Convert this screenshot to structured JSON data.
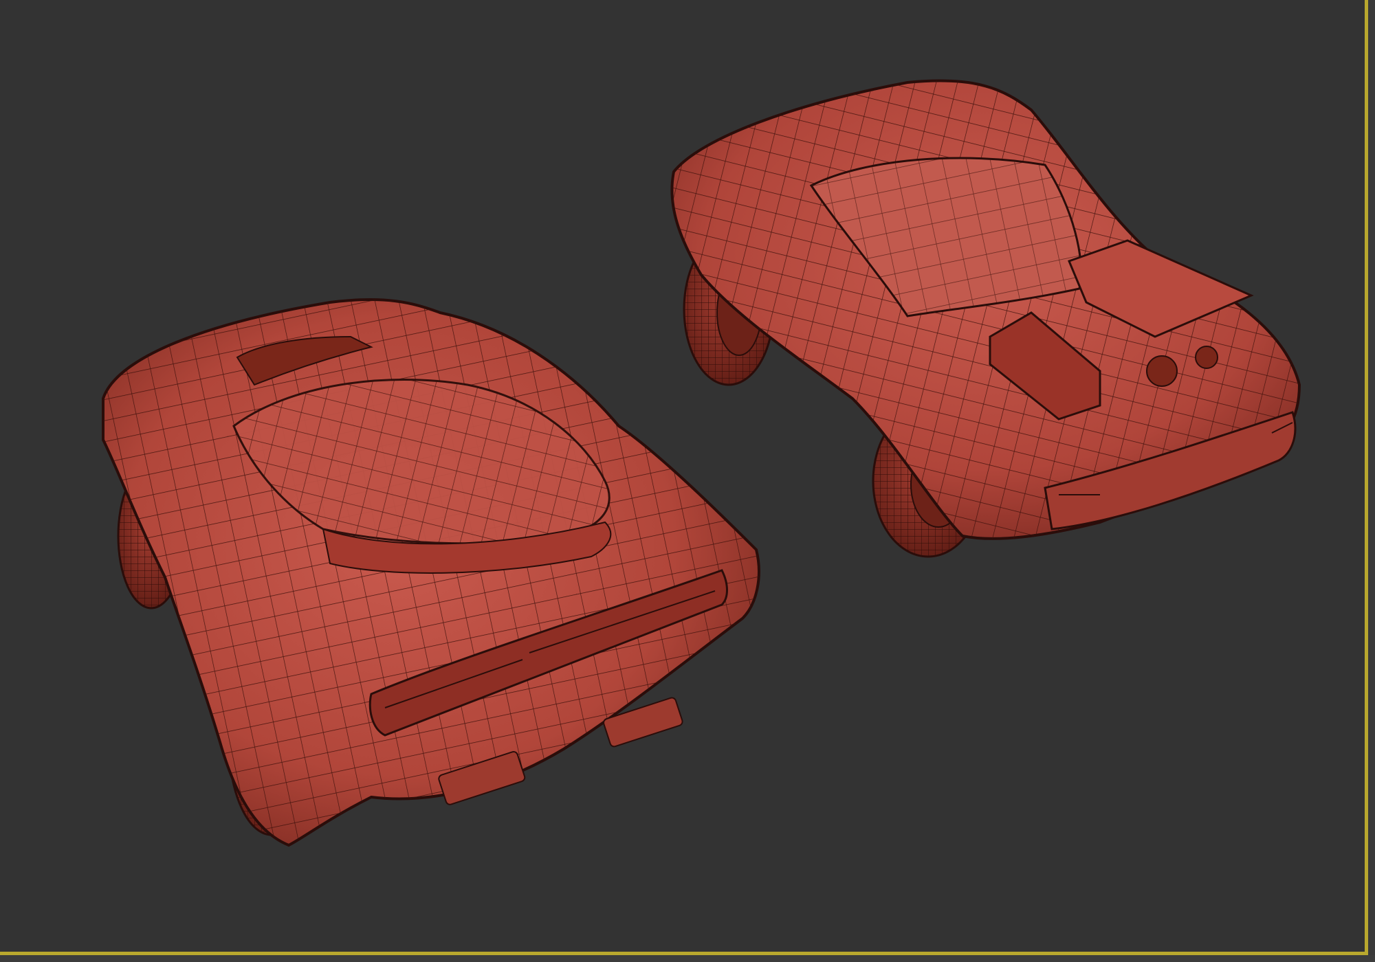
{
  "viewport": {
    "name": "perspective-viewport",
    "background_color": "#333333",
    "active_border_color": "#b9a82e"
  },
  "scene": {
    "objects": [
      {
        "name": "car-model-rear-view",
        "material_color": "#b8483c",
        "wire_color": "#2a0d0a",
        "render_mode": "shaded-with-wireframe"
      },
      {
        "name": "car-model-front-view",
        "material_color": "#b8483c",
        "wire_color": "#2a0d0a",
        "render_mode": "shaded-with-wireframe"
      }
    ]
  }
}
